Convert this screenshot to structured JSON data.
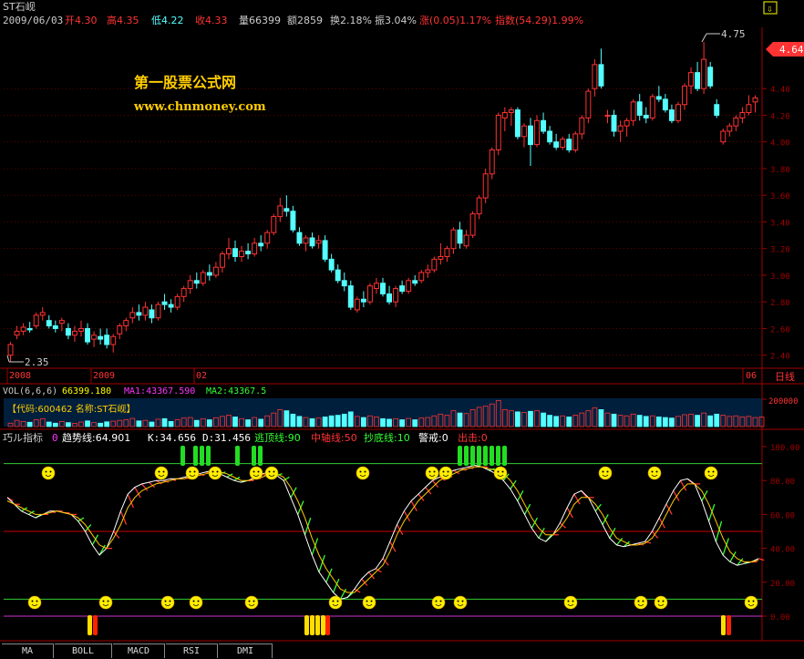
{
  "header": {
    "stock_name": "ST石岘",
    "date": "2009/06/03",
    "open_label": "开4.30",
    "high_label": "高4.35",
    "low_label": "低4.22",
    "close_label": "收4.33",
    "volume_label": "量66399",
    "amount_label": "额2859",
    "turnover_label": "换2.18%",
    "amplitude_label": "振3.04%",
    "change_label": "涨(0.05)1.17%",
    "index_label": "指数(54.29)1.99%"
  },
  "watermark": {
    "title": "第一股票公式网",
    "url": "www.chnmoney.com"
  },
  "price_panel": {
    "y_ticks": [
      "4.40",
      "4.20",
      "4.00",
      "3.80",
      "3.60",
      "3.40",
      "3.20",
      "3.00",
      "2.80",
      "2.60",
      "2.40"
    ],
    "current_price_tag": "4.64",
    "high_marker": "4.75",
    "low_marker": "2.35",
    "x_labels": [
      "2008",
      "2009",
      "02",
      "06"
    ],
    "daily_label": "日线"
  },
  "vol_panel": {
    "vol_title": "VOL(6,6,6)",
    "vol_value": "66399.180",
    "ma1_label": "MA1:43367.590",
    "ma2_label": "MA2:43367.5",
    "info_label": "【代码:600462 名称:ST石岘】",
    "y_tick": "200000"
  },
  "indicator_panel": {
    "name": "巧ル指标",
    "zero": "0",
    "trend_label": "趋势线:64.901",
    "k_label": "K:34.656",
    "d_label": "D:31.456",
    "escape_label": "逃顶线:90",
    "mid_label": "中轴线:50",
    "bottom_label": "抄底线:10",
    "warn_label": "警戒:0",
    "exit_label": "出击:0",
    "y_ticks": [
      "100.00",
      "80.00",
      "60.00",
      "40.00",
      "20.00",
      "0.00"
    ]
  },
  "tabs": [
    "MA",
    "BOLL",
    "MACD",
    "RSI",
    "DMI"
  ],
  "colors": {
    "up": "#ff3333",
    "down": "#54ffff",
    "grid": "#a00000",
    "text": "#cccccc"
  },
  "chart_data": [
    {
      "type": "candlestick",
      "title": "ST石岘",
      "ylim": [
        2.3,
        4.8
      ],
      "candles": [
        [
          2.4,
          2.5,
          2.35,
          2.48
        ],
        [
          2.55,
          2.62,
          2.52,
          2.58
        ],
        [
          2.58,
          2.64,
          2.55,
          2.61
        ],
        [
          2.6,
          2.65,
          2.57,
          2.59
        ],
        [
          2.62,
          2.72,
          2.6,
          2.7
        ],
        [
          2.7,
          2.76,
          2.66,
          2.72
        ],
        [
          2.66,
          2.7,
          2.6,
          2.62
        ],
        [
          2.62,
          2.66,
          2.57,
          2.6
        ],
        [
          2.64,
          2.68,
          2.58,
          2.66
        ],
        [
          2.6,
          2.64,
          2.52,
          2.55
        ],
        [
          2.55,
          2.62,
          2.5,
          2.58
        ],
        [
          2.58,
          2.66,
          2.54,
          2.6
        ],
        [
          2.6,
          2.64,
          2.48,
          2.5
        ],
        [
          2.52,
          2.58,
          2.46,
          2.55
        ],
        [
          2.54,
          2.6,
          2.48,
          2.52
        ],
        [
          2.55,
          2.6,
          2.45,
          2.48
        ],
        [
          2.48,
          2.56,
          2.42,
          2.54
        ],
        [
          2.56,
          2.64,
          2.52,
          2.62
        ],
        [
          2.62,
          2.68,
          2.58,
          2.66
        ],
        [
          2.68,
          2.76,
          2.64,
          2.72
        ],
        [
          2.72,
          2.78,
          2.66,
          2.7
        ],
        [
          2.7,
          2.8,
          2.66,
          2.76
        ],
        [
          2.74,
          2.78,
          2.64,
          2.68
        ],
        [
          2.68,
          2.8,
          2.66,
          2.78
        ],
        [
          2.8,
          2.86,
          2.74,
          2.78
        ],
        [
          2.78,
          2.82,
          2.72,
          2.76
        ],
        [
          2.76,
          2.86,
          2.74,
          2.84
        ],
        [
          2.84,
          2.92,
          2.8,
          2.9
        ],
        [
          2.9,
          3.0,
          2.86,
          2.96
        ],
        [
          2.96,
          3.02,
          2.9,
          2.94
        ],
        [
          2.94,
          3.04,
          2.92,
          3.02
        ],
        [
          3.02,
          3.08,
          2.96,
          3.0
        ],
        [
          3.0,
          3.1,
          2.98,
          3.06
        ],
        [
          3.06,
          3.18,
          3.02,
          3.16
        ],
        [
          3.16,
          3.28,
          3.12,
          3.2
        ],
        [
          3.2,
          3.26,
          3.1,
          3.14
        ],
        [
          3.14,
          3.22,
          3.1,
          3.18
        ],
        [
          3.18,
          3.24,
          3.12,
          3.16
        ],
        [
          3.16,
          3.28,
          3.14,
          3.24
        ],
        [
          3.24,
          3.3,
          3.18,
          3.22
        ],
        [
          3.24,
          3.34,
          3.2,
          3.32
        ],
        [
          3.32,
          3.46,
          3.3,
          3.44
        ],
        [
          3.44,
          3.58,
          3.4,
          3.52
        ],
        [
          3.5,
          3.6,
          3.44,
          3.48
        ],
        [
          3.48,
          3.52,
          3.32,
          3.34
        ],
        [
          3.32,
          3.36,
          3.22,
          3.24
        ],
        [
          3.24,
          3.3,
          3.18,
          3.28
        ],
        [
          3.28,
          3.32,
          3.2,
          3.22
        ],
        [
          3.24,
          3.3,
          3.2,
          3.26
        ],
        [
          3.26,
          3.3,
          3.1,
          3.12
        ],
        [
          3.12,
          3.16,
          3.02,
          3.04
        ],
        [
          3.04,
          3.08,
          2.94,
          2.96
        ],
        [
          2.96,
          3.02,
          2.88,
          2.92
        ],
        [
          2.92,
          2.96,
          2.74,
          2.76
        ],
        [
          2.74,
          2.84,
          2.72,
          2.82
        ],
        [
          2.82,
          2.88,
          2.76,
          2.8
        ],
        [
          2.8,
          2.94,
          2.78,
          2.92
        ],
        [
          2.9,
          2.98,
          2.86,
          2.94
        ],
        [
          2.94,
          2.98,
          2.84,
          2.86
        ],
        [
          2.86,
          2.92,
          2.78,
          2.8
        ],
        [
          2.8,
          2.92,
          2.76,
          2.9
        ],
        [
          2.92,
          2.96,
          2.86,
          2.88
        ],
        [
          2.88,
          2.98,
          2.86,
          2.96
        ],
        [
          2.96,
          3.0,
          2.92,
          2.94
        ],
        [
          2.96,
          3.04,
          2.94,
          3.02
        ],
        [
          3.02,
          3.08,
          2.98,
          3.04
        ],
        [
          3.04,
          3.14,
          3.02,
          3.12
        ],
        [
          3.12,
          3.24,
          3.08,
          3.14
        ],
        [
          3.14,
          3.22,
          3.1,
          3.2
        ],
        [
          3.2,
          3.36,
          3.16,
          3.34
        ],
        [
          3.34,
          3.4,
          3.2,
          3.24
        ],
        [
          3.22,
          3.34,
          3.2,
          3.3
        ],
        [
          3.3,
          3.48,
          3.28,
          3.46
        ],
        [
          3.46,
          3.6,
          3.42,
          3.58
        ],
        [
          3.58,
          3.8,
          3.54,
          3.76
        ],
        [
          3.76,
          3.96,
          3.72,
          3.94
        ],
        [
          3.94,
          4.22,
          3.9,
          4.2
        ],
        [
          4.18,
          4.26,
          4.08,
          4.22
        ],
        [
          4.22,
          4.26,
          4.12,
          4.24
        ],
        [
          4.24,
          4.26,
          4.02,
          4.04
        ],
        [
          4.04,
          4.14,
          3.96,
          4.12
        ],
        [
          4.12,
          4.18,
          3.82,
          3.98
        ],
        [
          3.98,
          4.2,
          3.96,
          4.16
        ],
        [
          4.16,
          4.22,
          4.06,
          4.08
        ],
        [
          4.08,
          4.12,
          3.98,
          4.0
        ],
        [
          4.0,
          4.06,
          3.94,
          3.96
        ],
        [
          3.96,
          4.04,
          3.94,
          4.02
        ],
        [
          4.02,
          4.06,
          3.92,
          3.94
        ],
        [
          3.94,
          4.08,
          3.92,
          4.06
        ],
        [
          4.06,
          4.2,
          4.02,
          4.18
        ],
        [
          4.18,
          4.4,
          4.14,
          4.38
        ],
        [
          4.4,
          4.62,
          4.34,
          4.58
        ],
        [
          4.58,
          4.7,
          4.4,
          4.42
        ],
        [
          4.2,
          4.24,
          4.14,
          4.2
        ],
        [
          4.2,
          4.24,
          4.04,
          4.08
        ],
        [
          4.08,
          4.16,
          4.0,
          4.12
        ],
        [
          4.12,
          4.18,
          4.04,
          4.16
        ],
        [
          4.16,
          4.32,
          4.12,
          4.3
        ],
        [
          4.3,
          4.36,
          4.16,
          4.2
        ],
        [
          4.2,
          4.26,
          4.14,
          4.18
        ],
        [
          4.18,
          4.36,
          4.16,
          4.34
        ],
        [
          4.34,
          4.42,
          4.3,
          4.32
        ],
        [
          4.32,
          4.36,
          4.22,
          4.24
        ],
        [
          4.24,
          4.28,
          4.14,
          4.16
        ],
        [
          4.16,
          4.3,
          4.14,
          4.28
        ],
        [
          4.28,
          4.44,
          4.24,
          4.42
        ],
        [
          4.42,
          4.56,
          4.36,
          4.52
        ],
        [
          4.52,
          4.6,
          4.38,
          4.4
        ],
        [
          4.4,
          4.75,
          4.36,
          4.62
        ],
        [
          4.56,
          4.6,
          4.4,
          4.42
        ],
        [
          4.28,
          4.32,
          4.18,
          4.2
        ],
        [
          4.0,
          4.1,
          3.98,
          4.08
        ],
        [
          4.08,
          4.14,
          4.04,
          4.12
        ],
        [
          4.12,
          4.2,
          4.08,
          4.18
        ],
        [
          4.18,
          4.26,
          4.14,
          4.22
        ],
        [
          4.22,
          4.35,
          4.2,
          4.28
        ],
        [
          4.3,
          4.35,
          4.22,
          4.33
        ]
      ]
    },
    {
      "type": "bar",
      "title": "VOL(6,6,6)",
      "ylim": [
        0,
        250000
      ],
      "values": [
        30,
        55,
        45,
        38,
        60,
        70,
        40,
        30,
        45,
        35,
        28,
        40,
        50,
        35,
        30,
        42,
        48,
        55,
        60,
        72,
        50,
        55,
        40,
        65,
        70,
        45,
        60,
        75,
        80,
        55,
        70,
        60,
        78,
        90,
        100,
        85,
        70,
        60,
        80,
        65,
        95,
        120,
        150,
        140,
        110,
        90,
        80,
        70,
        75,
        85,
        95,
        100,
        110,
        130,
        90,
        80,
        95,
        85,
        70,
        65,
        70,
        60,
        72,
        60,
        75,
        80,
        95,
        110,
        100,
        140,
        120,
        115,
        150,
        170,
        180,
        200,
        230,
        150,
        140,
        130,
        125,
        135,
        140,
        120,
        100,
        90,
        95,
        85,
        100,
        120,
        140,
        165,
        150,
        120,
        110,
        100,
        95,
        110,
        100,
        90,
        95,
        85,
        80,
        75,
        90,
        105,
        110,
        100,
        120,
        95,
        110,
        100,
        90,
        95,
        85,
        90,
        80,
        85
      ]
    },
    {
      "type": "line",
      "title": "巧ル指标",
      "ylim": [
        0,
        105
      ],
      "series": [
        {
          "name": "K",
          "values": [
            70,
            66,
            62,
            60,
            58,
            60,
            62,
            62,
            61,
            60,
            56,
            50,
            42,
            36,
            40,
            50,
            62,
            72,
            76,
            78,
            79,
            80,
            80,
            81,
            81,
            82,
            83,
            84,
            85,
            86,
            84,
            82,
            80,
            79,
            80,
            82,
            84,
            85,
            83,
            80,
            70,
            60,
            48,
            36,
            26,
            20,
            14,
            10,
            11,
            16,
            22,
            26,
            28,
            34,
            44,
            54,
            62,
            68,
            72,
            76,
            80,
            82,
            84,
            86,
            87,
            88,
            89,
            88,
            86,
            84,
            80,
            75,
            68,
            60,
            52,
            46,
            44,
            48,
            55,
            64,
            72,
            74,
            70,
            62,
            54,
            46,
            42,
            41,
            42,
            43,
            44,
            50,
            58,
            66,
            74,
            80,
            81,
            78,
            68,
            56,
            44,
            36,
            32,
            30,
            31,
            32,
            34
          ]
        },
        {
          "name": "D",
          "values": [
            68,
            66,
            64,
            62,
            60,
            60,
            61,
            62,
            61,
            60,
            58,
            54,
            48,
            42,
            40,
            46,
            54,
            64,
            70,
            74,
            76,
            78,
            79,
            80,
            81,
            81,
            82,
            83,
            84,
            85,
            85,
            84,
            82,
            80,
            80,
            81,
            82,
            84,
            84,
            82,
            76,
            68,
            58,
            46,
            36,
            28,
            22,
            16,
            14,
            14,
            18,
            22,
            26,
            30,
            38,
            48,
            56,
            62,
            68,
            72,
            76,
            80,
            82,
            84,
            86,
            87,
            88,
            88,
            87,
            86,
            84,
            80,
            74,
            66,
            58,
            52,
            48,
            48,
            52,
            58,
            66,
            70,
            70,
            66,
            60,
            52,
            46,
            44,
            42,
            42,
            43,
            46,
            52,
            60,
            68,
            74,
            78,
            78,
            74,
            66,
            56,
            46,
            38,
            34,
            32,
            32,
            33
          ]
        }
      ],
      "levels": {
        "escape": 90,
        "mid": 50,
        "bottom": 10,
        "warn": 0
      }
    }
  ]
}
